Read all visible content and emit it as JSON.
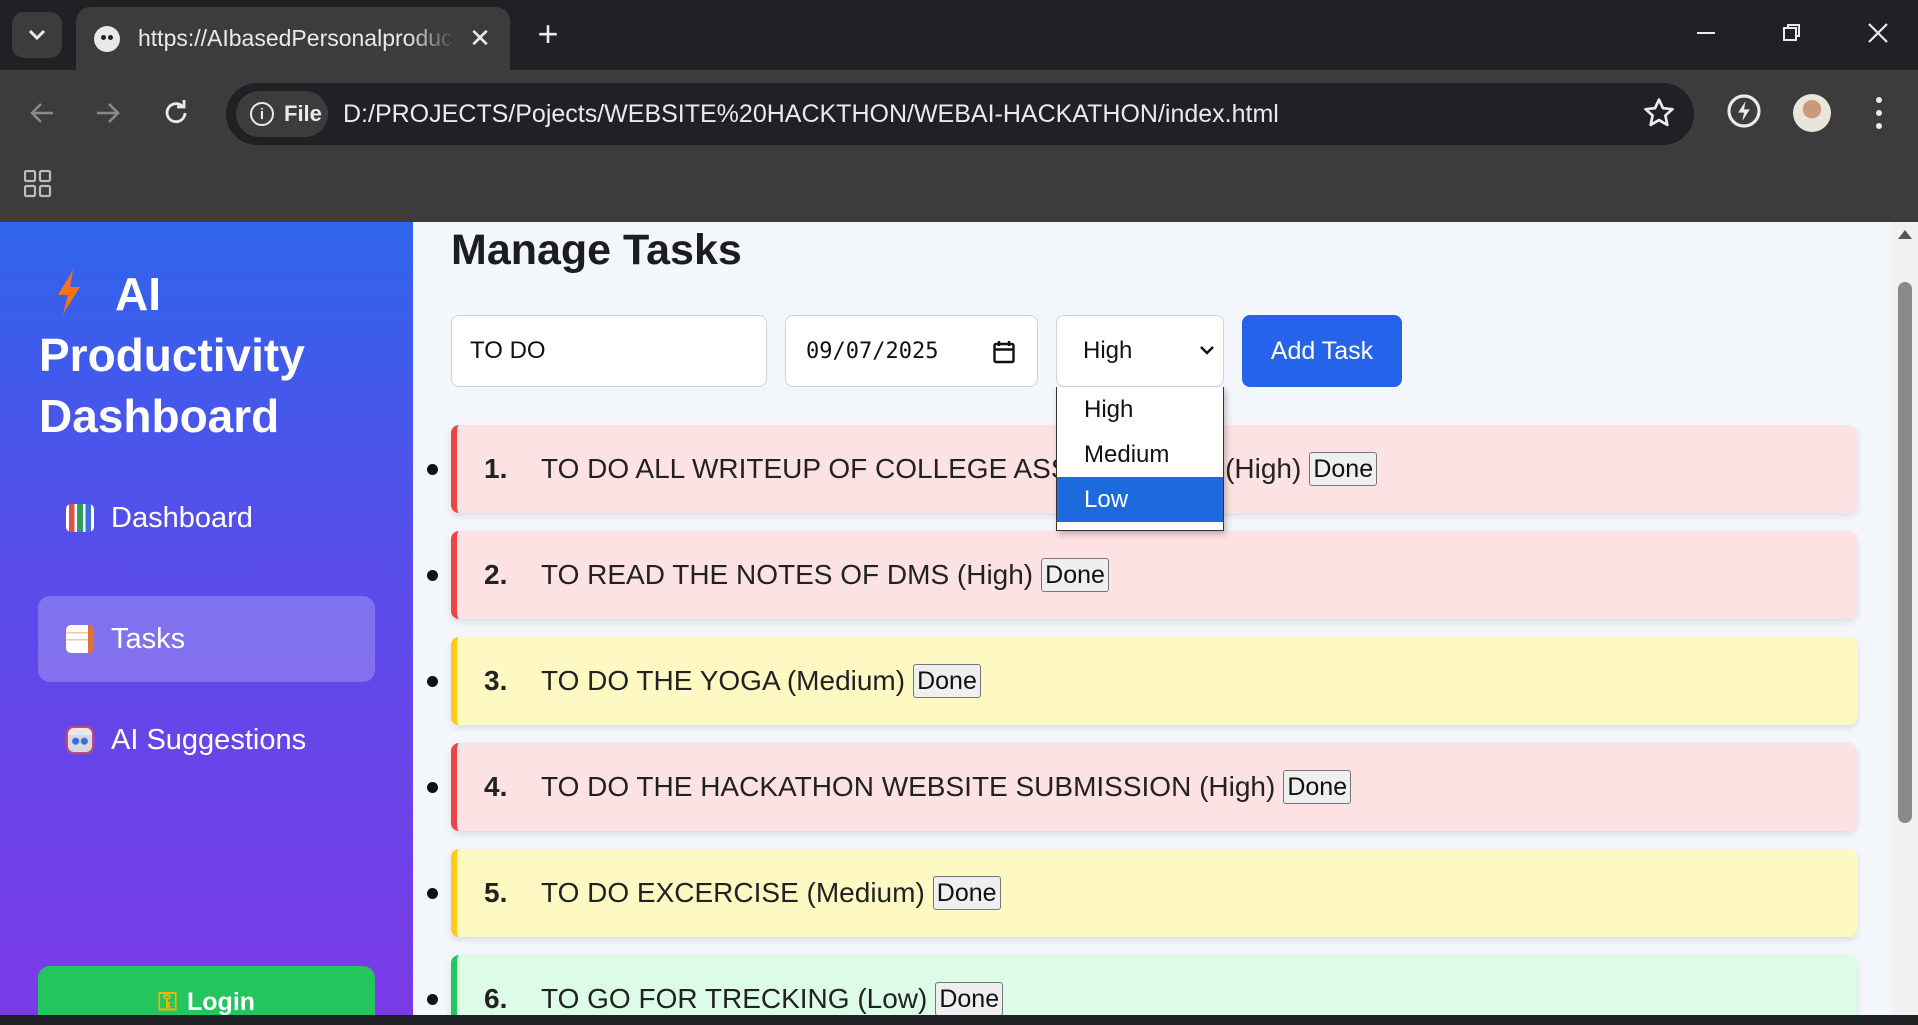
{
  "browser": {
    "tab_title": "https://AIbasedPersonalproductivityDashboard",
    "site_chip": "File",
    "url": "D:/PROJECTS/Pojects/WEBSITE%20HACKTHON/WEBAI-HACKATHON/index.html"
  },
  "sidebar": {
    "brand": "AI Productivity Dashboard",
    "items": [
      {
        "label": "Dashboard",
        "icon": "bar-chart-icon",
        "active": false
      },
      {
        "label": "Tasks",
        "icon": "memo-icon",
        "active": true
      },
      {
        "label": "AI Suggestions",
        "icon": "robot-icon",
        "active": false
      }
    ],
    "login_label": "Login",
    "login_icon": "key-icon"
  },
  "main": {
    "title": "Manage Tasks",
    "form": {
      "task_value": "TO DO",
      "date_value": "09/07/2025",
      "priority_selected": "High",
      "add_label": "Add Task"
    },
    "priority_options": [
      {
        "label": "High",
        "highlighted": false
      },
      {
        "label": "Medium",
        "highlighted": false
      },
      {
        "label": "Low",
        "highlighted": true
      }
    ],
    "tasks": [
      {
        "num": "1.",
        "text": "TO DO ALL WRITEUP OF COLLEGE ASSIGNMENTS (High)",
        "priority": "high",
        "done_label": "Done"
      },
      {
        "num": "2.",
        "text": "TO READ THE NOTES OF DMS (High)",
        "priority": "high",
        "done_label": "Done"
      },
      {
        "num": "3.",
        "text": "TO DO THE YOGA (Medium)",
        "priority": "medium",
        "done_label": "Done"
      },
      {
        "num": "4.",
        "text": "TO DO THE HACKATHON WEBSITE SUBMISSION (High)",
        "priority": "high",
        "done_label": "Done"
      },
      {
        "num": "5.",
        "text": "TO DO EXCERCISE (Medium)",
        "priority": "medium",
        "done_label": "Done"
      },
      {
        "num": "6.",
        "text": "TO GO FOR TRECKING (Low)",
        "priority": "low",
        "done_label": "Done"
      }
    ]
  },
  "colors": {
    "high_bg": "#fde2e4",
    "high_border": "#ef4444",
    "medium_bg": "#fef9c3",
    "medium_border": "#facc15",
    "low_bg": "#dcfce7",
    "low_border": "#22c55e",
    "accent": "#2563eb"
  }
}
